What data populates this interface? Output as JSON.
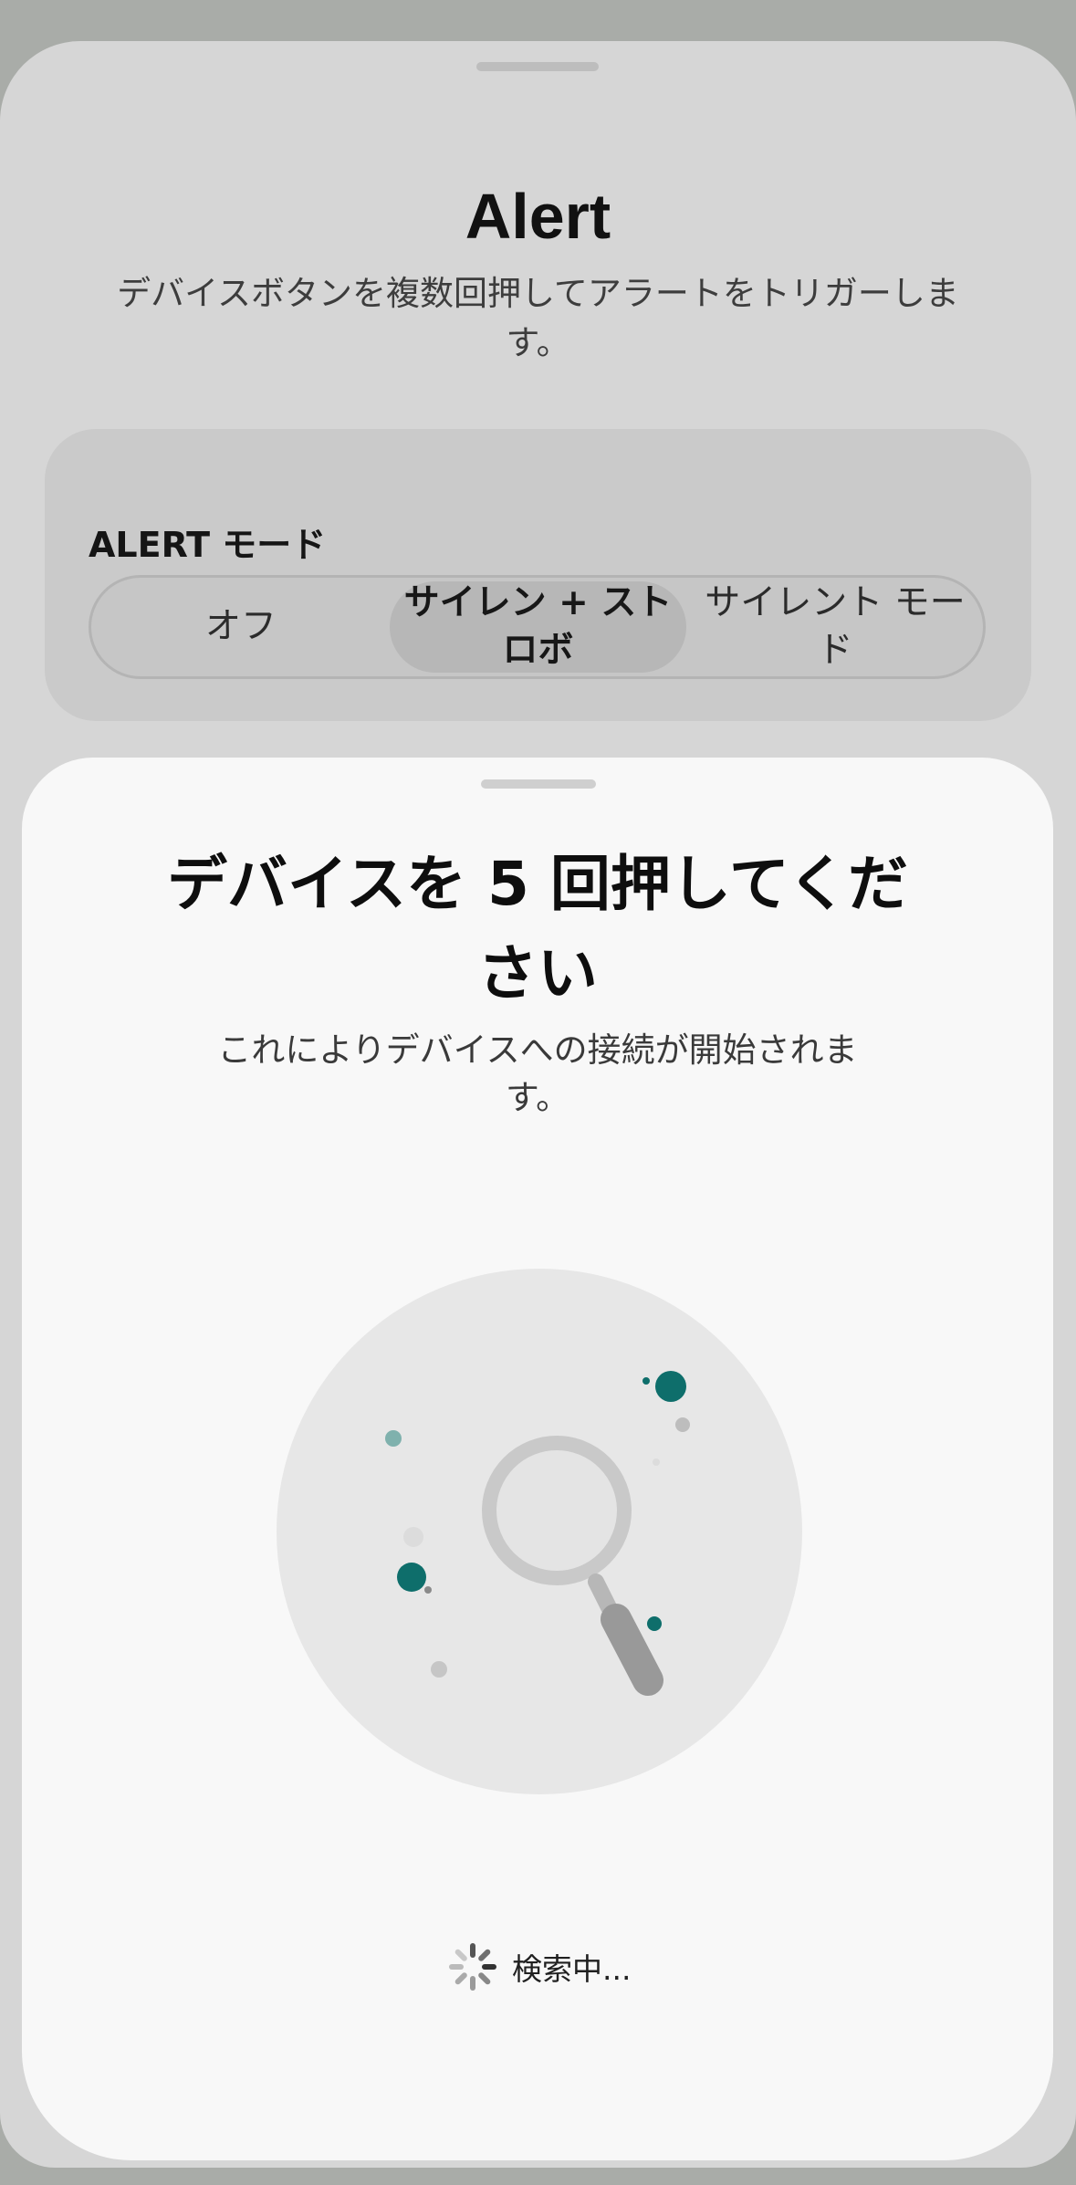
{
  "alert_sheet": {
    "title": "Alert",
    "subtitle": "デバイスボタンを複数回押してアラートをトリガーします。",
    "mode_card": {
      "label": "ALERT モード",
      "options": [
        {
          "label": "オフ",
          "selected": false
        },
        {
          "label": "サイレン + ストロボ",
          "selected": true
        },
        {
          "label": "サイレント モード",
          "selected": false
        }
      ]
    }
  },
  "pairing_sheet": {
    "title": "デバイスを 5 回押してください",
    "subtitle": "これによりデバイスへの接続が開始されます。",
    "illustration_icon": "magnifying-glass-icon",
    "status": {
      "icon": "spinner-icon",
      "label": "検索中..."
    }
  },
  "colors": {
    "accent_teal": "#0e6e6b",
    "sheet_background": "#f8f8f8",
    "backdrop": "#d6d6d6"
  }
}
